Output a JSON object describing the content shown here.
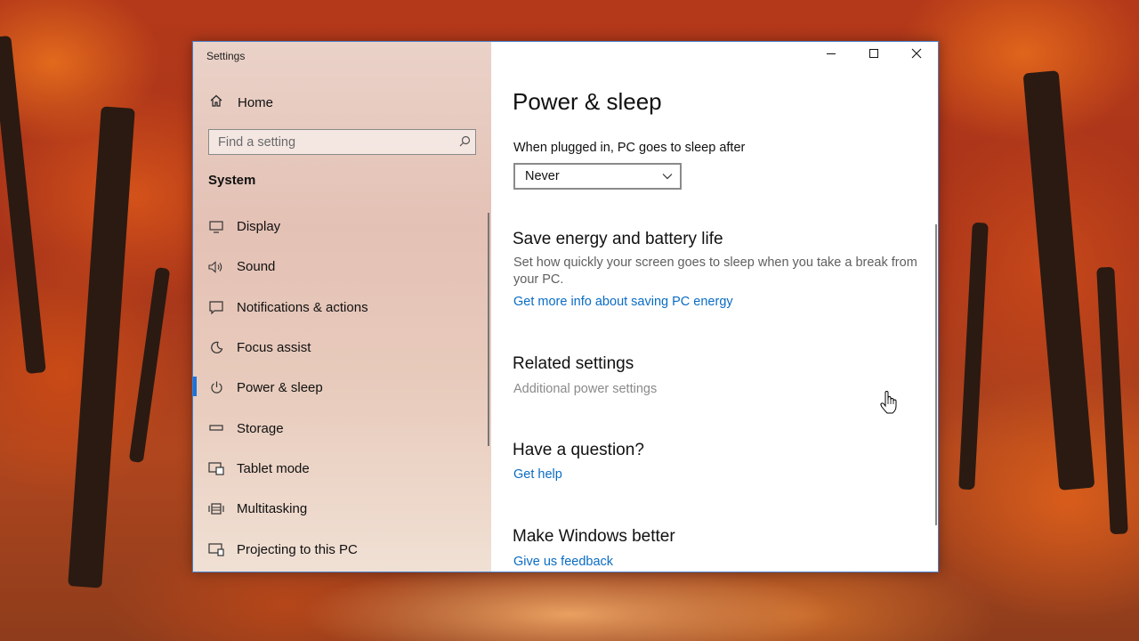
{
  "window": {
    "app_title": "Settings",
    "caption_icons": [
      "minimize-icon",
      "maximize-icon",
      "close-icon"
    ]
  },
  "sidebar": {
    "home": {
      "label": "Home",
      "icon": "home-icon"
    },
    "search": {
      "placeholder": "Find a setting",
      "icon": "search-icon"
    },
    "section": "System",
    "items": [
      {
        "label": "Display",
        "icon": "display-icon",
        "selected": false
      },
      {
        "label": "Sound",
        "icon": "sound-icon",
        "selected": false
      },
      {
        "label": "Notifications & actions",
        "icon": "notifications-icon",
        "selected": false
      },
      {
        "label": "Focus assist",
        "icon": "focus-assist-icon",
        "selected": false
      },
      {
        "label": "Power & sleep",
        "icon": "power-icon",
        "selected": true
      },
      {
        "label": "Storage",
        "icon": "storage-icon",
        "selected": false
      },
      {
        "label": "Tablet mode",
        "icon": "tablet-mode-icon",
        "selected": false
      },
      {
        "label": "Multitasking",
        "icon": "multitasking-icon",
        "selected": false
      },
      {
        "label": "Projecting to this PC",
        "icon": "projecting-icon",
        "selected": false
      }
    ]
  },
  "content": {
    "title": "Power & sleep",
    "plugged_in_label": "When plugged in, PC goes to sleep after",
    "sleep_dropdown_value": "Never",
    "save_energy": {
      "heading": "Save energy and battery life",
      "description": "Set how quickly your screen goes to sleep when you take a break from your PC.",
      "link": "Get more info about saving PC energy"
    },
    "related": {
      "heading": "Related settings",
      "link": "Additional power settings"
    },
    "question": {
      "heading": "Have a question?",
      "link": "Get help"
    },
    "better": {
      "heading": "Make Windows better",
      "link": "Give us feedback"
    }
  },
  "colors": {
    "accent": "#1a73d8",
    "link": "#0a6cc4",
    "window_border": "#4a7fc8"
  }
}
